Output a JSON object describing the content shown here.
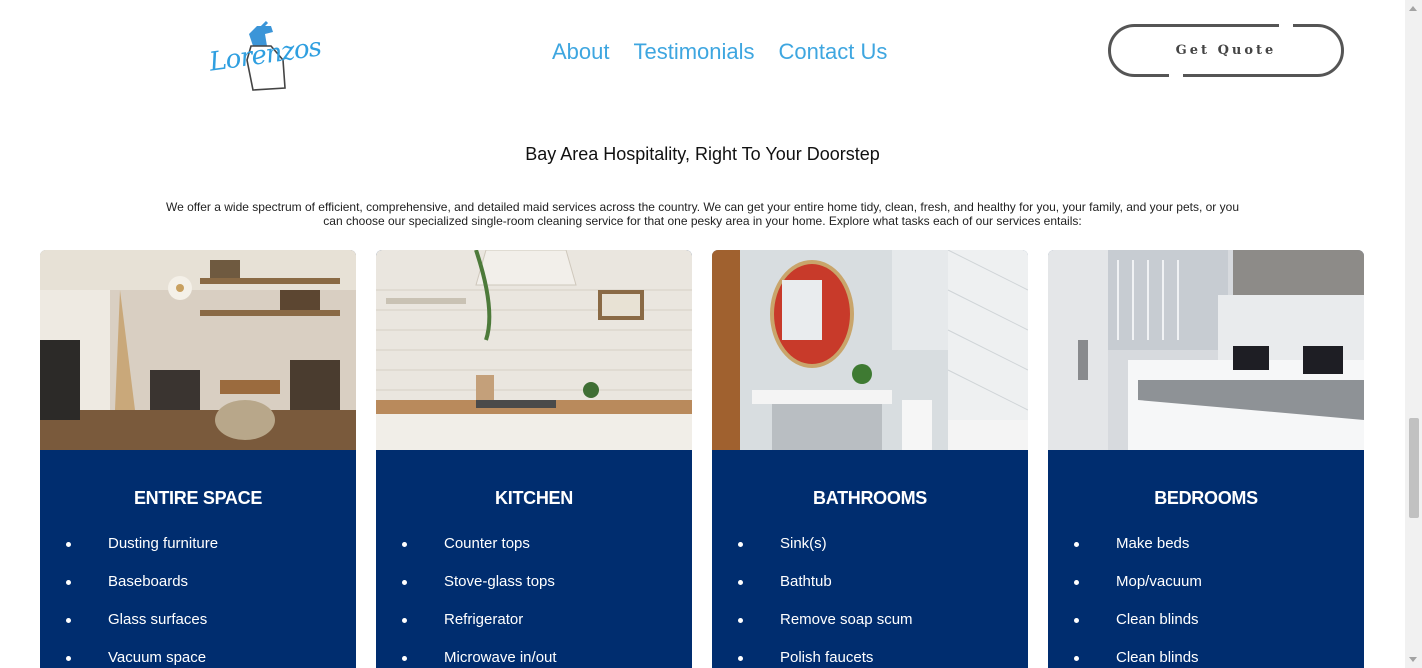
{
  "header": {
    "logo_text": "Lorenzos",
    "nav": [
      "About",
      "Testimonials",
      "Contact Us"
    ],
    "cta_label": "Get Quote"
  },
  "headline": "Bay Area Hospitality, Right To Your Doorstep",
  "intro": "We offer a wide spectrum of efficient, comprehensive, and detailed maid services across the country. We can get your entire home tidy, clean, fresh, and healthy for you, your family, and your pets, or you can choose our specialized single-room cleaning service for that one pesky area in your home. Explore what tasks each of our services entails:",
  "colors": {
    "accent": "#3ea6e0",
    "card_bg": "#002d6f",
    "button_border": "#555555"
  },
  "cards": [
    {
      "title": "ENTIRE SPACE",
      "image": "living-room-photo",
      "items": [
        "Dusting furniture",
        "Baseboards",
        "Glass surfaces",
        "Vacuum space"
      ]
    },
    {
      "title": "KITCHEN",
      "image": "kitchen-photo",
      "items": [
        "Counter tops",
        "Stove-glass tops",
        "Refrigerator",
        "Microwave in/out"
      ]
    },
    {
      "title": "BATHROOMS",
      "image": "bathroom-photo",
      "items": [
        "Sink(s)",
        "Bathtub",
        "Remove soap scum",
        "Polish faucets"
      ]
    },
    {
      "title": "BEDROOMS",
      "image": "bedroom-photo",
      "items": [
        "Make beds",
        "Mop/vacuum",
        "Clean blinds",
        "Clean blinds"
      ]
    }
  ]
}
